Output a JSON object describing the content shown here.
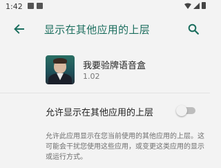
{
  "status_bar": {
    "time": "1:42",
    "left_icons": [
      "notification-icon",
      "notification-icon"
    ],
    "right_icons": [
      "wifi-icon",
      "signal-icon",
      "battery-icon"
    ]
  },
  "toolbar": {
    "title": "显示在其他应用的上层",
    "back_icon": "arrow-back-icon",
    "search_icon": "search-icon"
  },
  "app": {
    "name": "我要验牌语音盒",
    "version": "1.02"
  },
  "permission": {
    "label": "允许显示在其他应用的上层",
    "enabled": false
  },
  "description": "允许此应用显示在您当前使用的其他应用的上层。这可能会干扰您使用这些应用，或变更这类应用的显示或运行方式。",
  "colors": {
    "accent": "#1B6E5E",
    "background": "#F3F3F3",
    "toggle_track": "#BDBDBD"
  }
}
